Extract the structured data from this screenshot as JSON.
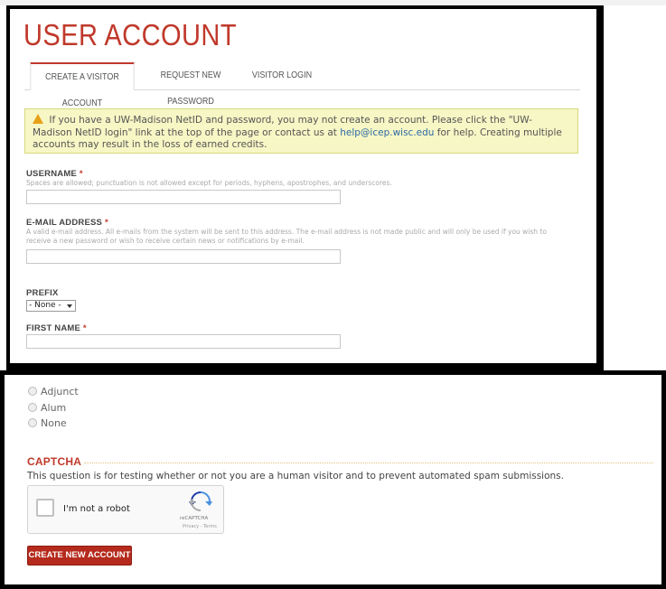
{
  "colors": {
    "accent": "#c0392b",
    "link": "#2c6aa6",
    "alert_bg": "#f7f6c5",
    "button": "#b52a1c"
  },
  "header": {
    "page_title": "USER ACCOUNT"
  },
  "tabs": [
    {
      "label": "CREATE A VISITOR ACCOUNT",
      "active": true
    },
    {
      "label": "REQUEST NEW PASSWORD",
      "active": false
    },
    {
      "label": "VISITOR LOGIN",
      "active": false
    }
  ],
  "alert": {
    "icon": "warning-icon",
    "text_before_link": "If you have a UW-Madison NetID and password, you may not create an account. Please click the \"UW-Madison NetID login\" link at the top of the page or contact us at ",
    "link_text": "help@icep.wisc.edu",
    "text_after_link": " for help. Creating multiple accounts may result in the loss of earned credits."
  },
  "form": {
    "username": {
      "label": "USERNAME",
      "required_mark": "*",
      "help": "Spaces are allowed; punctuation is not allowed except for periods, hyphens, apostrophes, and underscores.",
      "value": ""
    },
    "email": {
      "label": "E-MAIL ADDRESS",
      "required_mark": "*",
      "help": "A valid e-mail address. All e-mails from the system will be sent to this address. The e-mail address is not made public and will only be used if you wish to receive a new password or wish to receive certain news or notifications by e-mail.",
      "value": ""
    },
    "prefix": {
      "label": "PREFIX",
      "selected": "- None -"
    },
    "first_name": {
      "label": "FIRST NAME",
      "required_mark": "*",
      "value": ""
    },
    "radio_options": [
      "Adjunct",
      "Alum",
      "None"
    ]
  },
  "captcha": {
    "title": "CAPTCHA",
    "description": "This question is for testing whether or not you are a human visitor and to prevent automated spam submissions.",
    "checkbox_label": "I'm not a robot",
    "brand": "reCAPTCHA",
    "privacy": "Privacy - Terms"
  },
  "submit": {
    "label": "CREATE NEW ACCOUNT"
  }
}
